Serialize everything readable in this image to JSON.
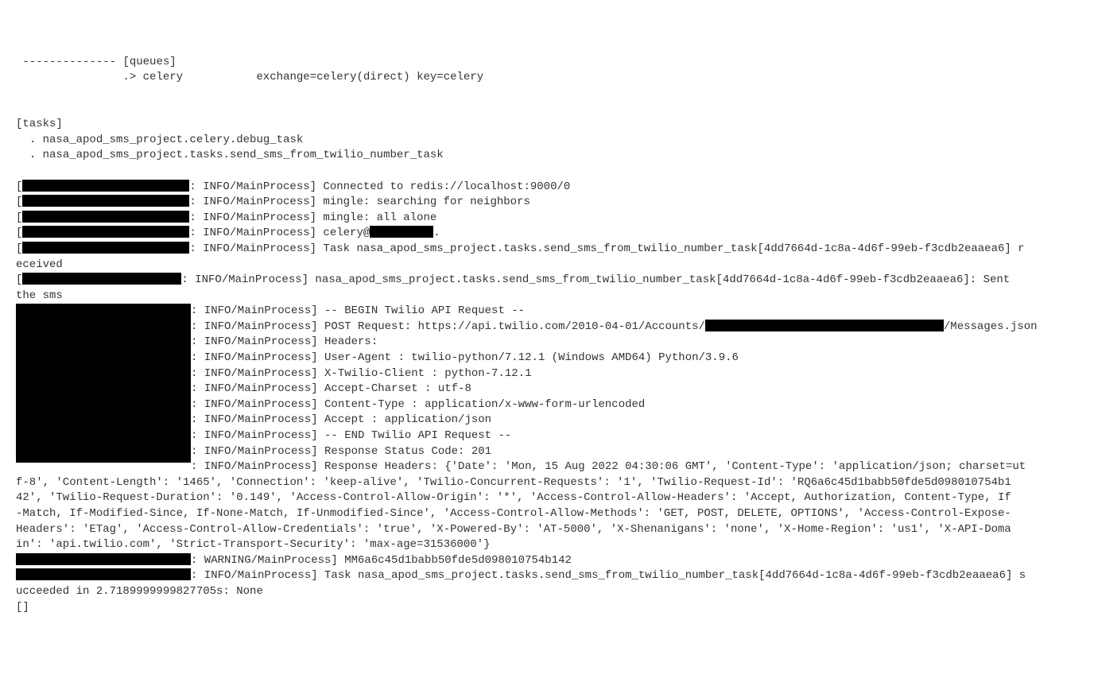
{
  "header": {
    "dashes": " -------------- ",
    "queues_label": "[queues]",
    "line2_prefix": "                .> celery",
    "line2_suffix": "           exchange=celery(direct) key=celery"
  },
  "tasks_header": "[tasks]",
  "task1": "  . nasa_apod_sms_project.celery.debug_task",
  "task2": "  . nasa_apod_sms_project.tasks.send_sms_from_twilio_number_task",
  "l1": ": INFO/MainProcess] Connected to redis://localhost:9000/0",
  "l2": ": INFO/MainProcess] mingle: searching for neighbors",
  "l3": ": INFO/MainProcess] mingle: all alone",
  "l4a": ": INFO/MainProcess] celery@",
  "l4b": ".",
  "l5": ": INFO/MainProcess] Task nasa_apod_sms_project.tasks.send_sms_from_twilio_number_task[4dd7664d-1c8a-4d6f-99eb-f3cdb2eaaea6] r",
  "l5b": "eceived",
  "l6": ": INFO/MainProcess] nasa_apod_sms_project.tasks.send_sms_from_twilio_number_task[4dd7664d-1c8a-4d6f-99eb-f3cdb2eaaea6]: Sent ",
  "l6b": "the sms",
  "b1": ": INFO/MainProcess] -- BEGIN Twilio API Request --",
  "b2a": ": INFO/MainProcess] POST Request: https://api.twilio.com/2010-04-01/Accounts/",
  "b2b": "/Messages.json",
  "b3": ": INFO/MainProcess] Headers:",
  "b4": ": INFO/MainProcess] User-Agent : twilio-python/7.12.1 (Windows AMD64) Python/3.9.6",
  "b5": ": INFO/MainProcess] X-Twilio-Client : python-7.12.1",
  "b6": ": INFO/MainProcess] Accept-Charset : utf-8",
  "b7": ": INFO/MainProcess] Content-Type : application/x-www-form-urlencoded",
  "b8": ": INFO/MainProcess] Accept : application/json",
  "b9": ": INFO/MainProcess] -- END Twilio API Request --",
  "b10": ": INFO/MainProcess] Response Status Code: 201",
  "rh1": ": INFO/MainProcess] Response Headers: {'Date': 'Mon, 15 Aug 2022 04:30:06 GMT', 'Content-Type': 'application/json; charset=ut",
  "rh2": "f-8', 'Content-Length': '1465', 'Connection': 'keep-alive', 'Twilio-Concurrent-Requests': '1', 'Twilio-Request-Id': 'RQ6a6c45d1babb50fde5d098010754b1",
  "rh3": "42', 'Twilio-Request-Duration': '0.149', 'Access-Control-Allow-Origin': '*', 'Access-Control-Allow-Headers': 'Accept, Authorization, Content-Type, If",
  "rh4": "-Match, If-Modified-Since, If-None-Match, If-Unmodified-Since', 'Access-Control-Allow-Methods': 'GET, POST, DELETE, OPTIONS', 'Access-Control-Expose-",
  "rh5": "Headers': 'ETag', 'Access-Control-Allow-Credentials': 'true', 'X-Powered-By': 'AT-5000', 'X-Shenanigans': 'none', 'X-Home-Region': 'us1', 'X-API-Doma",
  "rh6": "in': 'api.twilio.com', 'Strict-Transport-Security': 'max-age=31536000'}",
  "w1": ": WARNING/MainProcess] MM6a6c45d1babb50fde5d098010754b142",
  "w2": ": INFO/MainProcess] Task nasa_apod_sms_project.tasks.send_sms_from_twilio_number_task[4dd7664d-1c8a-4d6f-99eb-f3cdb2eaaea6] s",
  "w3": "ucceeded in 2.7189999999827705s: None",
  "cursor": "[]"
}
